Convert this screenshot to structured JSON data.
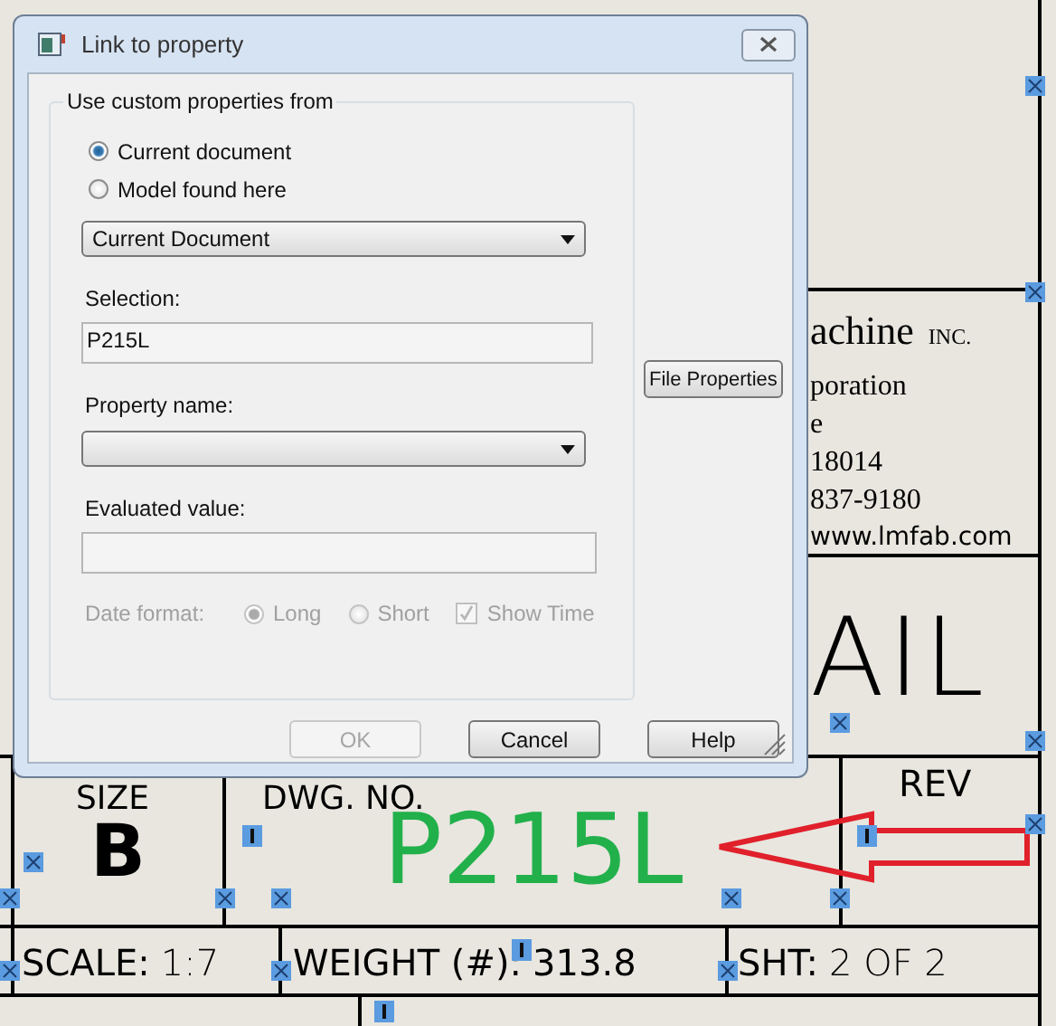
{
  "drawing": {
    "company": {
      "name": "achine",
      "suffix": "INC.",
      "lines": [
        "poration",
        "e",
        "18014",
        "837-9180",
        "www.lmfab.com"
      ]
    },
    "title_fragment": "AIL",
    "size": {
      "label": "SIZE",
      "value": "B"
    },
    "dwg_no": {
      "label": "DWG. NO.",
      "value": "P215L"
    },
    "rev": {
      "label": "REV"
    },
    "scale": {
      "label": "SCALE:",
      "value": "1:7"
    },
    "weight": {
      "label": "WEIGHT (#):",
      "value": "313.8"
    },
    "sheet": {
      "label": "SHT:",
      "value": "2 OF 2"
    }
  },
  "dialog": {
    "title": "Link to property",
    "group": {
      "legend": "Use custom properties from",
      "options": [
        {
          "label": "Current document",
          "selected": true
        },
        {
          "label": "Model found here",
          "selected": false
        }
      ],
      "source": {
        "value": "Current Document"
      },
      "selection": {
        "label": "Selection:",
        "value": "P215L"
      },
      "property_name": {
        "label": "Property name:"
      },
      "evaluated_value": {
        "label": "Evaluated value:"
      },
      "date_format": {
        "label": "Date format:",
        "disabled": true,
        "options": [
          {
            "label": "Long",
            "selected": true
          },
          {
            "label": "Short",
            "selected": false
          }
        ],
        "show_time": {
          "label": "Show Time",
          "checked": true
        }
      }
    },
    "file_properties_button": "File Properties",
    "buttons": [
      {
        "label": "OK",
        "disabled": true
      },
      {
        "label": "Cancel",
        "disabled": false
      },
      {
        "label": "Help",
        "disabled": false
      }
    ]
  }
}
